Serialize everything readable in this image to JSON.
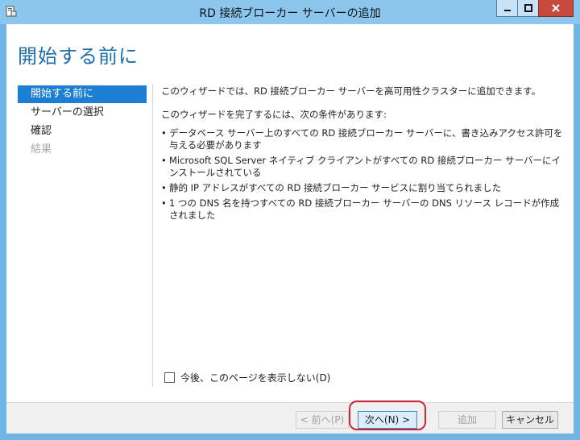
{
  "window": {
    "title": "RD 接続ブローカー サーバーの追加",
    "controls": {
      "minimize": "—",
      "maximize": "□",
      "close": "✕"
    }
  },
  "page": {
    "title": "開始する前に"
  },
  "nav": {
    "items": [
      {
        "label": "開始する前に",
        "state": "active"
      },
      {
        "label": "サーバーの選択",
        "state": "normal"
      },
      {
        "label": "確認",
        "state": "normal"
      },
      {
        "label": "結果",
        "state": "disabled"
      }
    ]
  },
  "content": {
    "intro": "このウィザードでは、RD 接続ブローカー サーバーを高可用性クラスターに追加できます。",
    "requirements_heading": "このウィザードを完了するには、次の条件があります:",
    "bullet_symbol": "•",
    "requirements": [
      "データベース サーバー上のすべての RD 接続ブローカー サーバーに、書き込みアクセス許可を与える必要があります",
      "Microsoft SQL Server ネイティブ クライアントがすべての RD 接続ブローカー サーバーにインストールされている",
      "静的 IP アドレスがすべての RD 接続ブローカー サービスに割り当てられました",
      "1 つの DNS 名を持つすべての RD 接続ブローカー サーバーの DNS リソース レコードが作成されました"
    ]
  },
  "options": {
    "skip_page_label": "今後、このページを表示しない(D)",
    "skip_page_checked": false
  },
  "buttons": {
    "previous": "< 前へ(P)",
    "next": "次へ(N) >",
    "add": "追加",
    "cancel": "キャンセル"
  },
  "colors": {
    "accent": "#1c7fd3",
    "title_color": "#1d6fa9",
    "highlight": "#d2233a"
  }
}
